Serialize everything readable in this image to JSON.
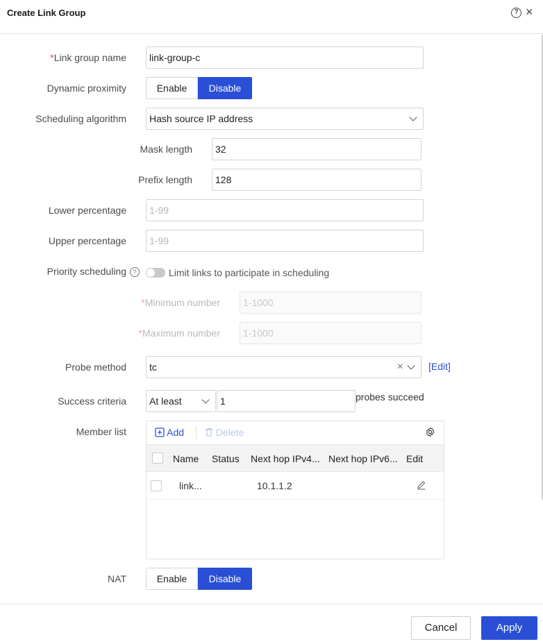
{
  "dialog": {
    "title": "Create Link Group",
    "help_icon": "?",
    "close_icon": "×"
  },
  "form": {
    "link_group_name": {
      "required_mark": "*",
      "label": "Link group name",
      "value": "link-group-c"
    },
    "dynamic_proximity": {
      "label": "Dynamic proximity",
      "options": [
        "Enable",
        "Disable"
      ],
      "selected": "Disable"
    },
    "scheduling_algorithm": {
      "label": "Scheduling algorithm",
      "value": "Hash source IP address"
    },
    "mask_length": {
      "label": "Mask length",
      "value": "32"
    },
    "prefix_length": {
      "label": "Prefix length",
      "value": "128"
    },
    "lower_percentage": {
      "label": "Lower percentage",
      "placeholder": "1-99"
    },
    "upper_percentage": {
      "label": "Upper percentage",
      "placeholder": "1-99"
    },
    "priority_scheduling": {
      "label": "Priority scheduling",
      "toggle_label": "Limit links to participate in scheduling",
      "enabled": false
    },
    "minimum_number": {
      "required_mark": "*",
      "label": "Minimum number",
      "placeholder": "1-1000"
    },
    "maximum_number": {
      "required_mark": "*",
      "label": "Maximum number",
      "placeholder": "1-1000"
    },
    "probe_method": {
      "label": "Probe method",
      "value": "tc",
      "edit_link": "[Edit]"
    },
    "success_criteria": {
      "label": "Success criteria",
      "select_value": "At least",
      "count": "1",
      "suffix": "probes succeed"
    },
    "member_list": {
      "label": "Member list",
      "add_label": "Add",
      "delete_label": "Delete",
      "columns": [
        "Name",
        "Status",
        "Next hop IPv4...",
        "Next hop IPv6...",
        "Edit"
      ],
      "rows": [
        {
          "name": "link...",
          "status": "",
          "next_hop_ipv4": "10.1.1.2",
          "next_hop_ipv6": ""
        }
      ]
    },
    "nat": {
      "label": "NAT",
      "options": [
        "Enable",
        "Disable"
      ],
      "selected": "Disable"
    }
  },
  "footer": {
    "cancel_label": "Cancel",
    "apply_label": "Apply"
  },
  "colors": {
    "primary": "#2a4fd6",
    "required": "#e5484d"
  }
}
